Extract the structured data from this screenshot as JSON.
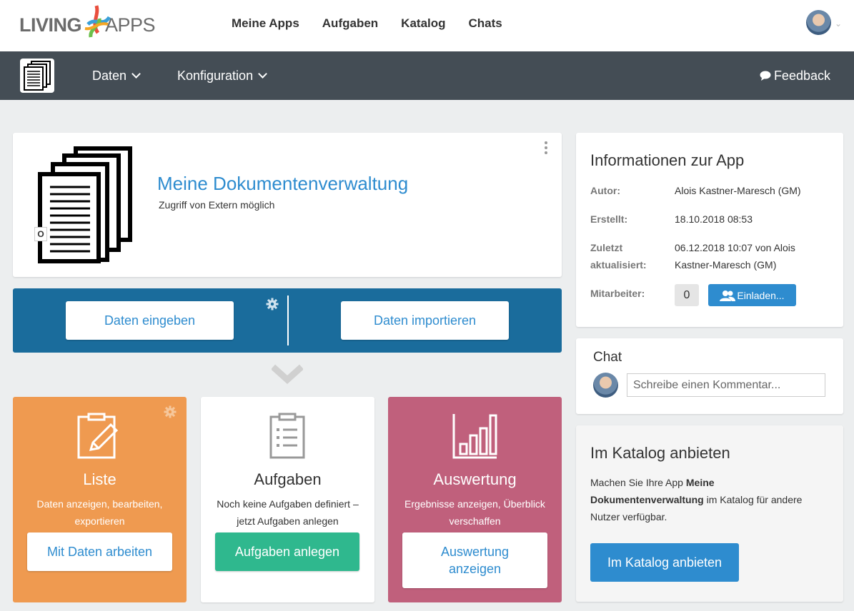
{
  "brand": {
    "logo_left": "LIVING",
    "logo_right": "APPS"
  },
  "topnav": {
    "items": [
      "Meine Apps",
      "Aufgaben",
      "Katalog",
      "Chats"
    ]
  },
  "subnav": {
    "daten": "Daten",
    "konfiguration": "Konfiguration",
    "feedback": "Feedback"
  },
  "app": {
    "title": "Meine Dokumentenverwaltung",
    "subtitle": "Zugriff von Extern möglich",
    "badge": "O"
  },
  "actions": {
    "enter": "Daten eingeben",
    "import": "Daten importieren"
  },
  "tiles": [
    {
      "title": "Liste",
      "desc": "Daten anzeigen, bearbeiten, exportieren",
      "button": "Mit Daten arbeiten",
      "color": "#ef9a50"
    },
    {
      "title": "Aufgaben",
      "desc": "Noch keine Aufgaben definiert – jetzt Aufgaben anlegen",
      "button": "Aufgaben anlegen",
      "color": "#2fb88e"
    },
    {
      "title": "Auswertung",
      "desc": "Ergebnisse anzeigen, Überblick verschaffen",
      "button": "Auswertung anzeigen",
      "color": "#c0607c"
    }
  ],
  "info": {
    "title": "Informationen zur App",
    "author_label": "Autor:",
    "author": "Alois Kastner-Maresch (GM)",
    "created_label": "Erstellt:",
    "created": "18.10.2018 08:53",
    "updated_label": "Zuletzt aktualisiert:",
    "updated": "06.12.2018 10:07 von Alois Kastner-Maresch (GM)",
    "members_label": "Mitarbeiter:",
    "members_count": "0",
    "invite": "Einladen..."
  },
  "chat": {
    "title": "Chat",
    "placeholder": "Schreibe einen Kommentar..."
  },
  "catalog": {
    "title": "Im Katalog anbieten",
    "desc_pre": "Machen Sie Ihre App ",
    "desc_bold": "Meine Dokumentenverwaltung",
    "desc_post": " im Katalog für andere Nutzer verfügbar.",
    "button": "Im Katalog anbieten"
  },
  "colors": {
    "accent": "#2e8ccf",
    "header_dark": "#444d55",
    "action_bar": "#1a6c9c"
  }
}
